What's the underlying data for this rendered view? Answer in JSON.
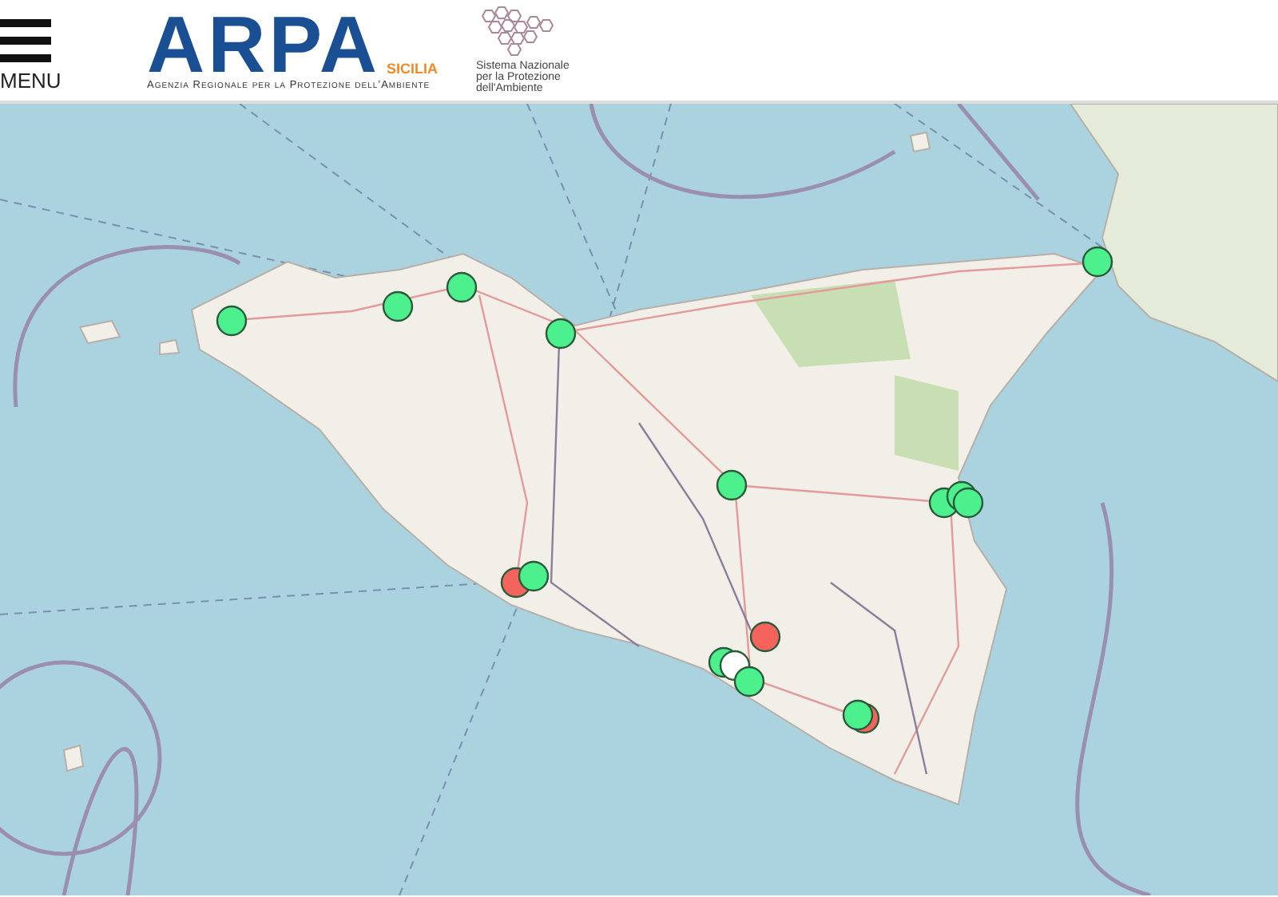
{
  "header": {
    "menu_label": "MENU",
    "logo": {
      "letters": "ARPA",
      "region": "SICILIA",
      "tagline": "Agenzia Regionale per la Protezione dell’Ambiente"
    },
    "partner": {
      "lines": [
        "Sistema Nazionale",
        "per la Protezione",
        "dell'Ambiente"
      ]
    }
  },
  "map": {
    "markers": [
      {
        "color": "#4cf08c"
      },
      {
        "color": "#4cf08c"
      },
      {
        "color": "#4cf08c"
      },
      {
        "color": "#4cf08c"
      },
      {
        "color": "#4cf08c"
      },
      {
        "color": "#4cf08c"
      },
      {
        "color": "#4cf08c"
      },
      {
        "color": "#4cf08c"
      },
      {
        "color": "#4cf08c"
      },
      {
        "color": "#f4645c"
      },
      {
        "color": "#4cf08c"
      },
      {
        "color": "#f4645c"
      },
      {
        "color": "#4cf08c"
      },
      {
        "color": "#ffffff"
      },
      {
        "color": "#4cf08c"
      },
      {
        "color": "#f4645c"
      },
      {
        "color": "#4cf08c"
      }
    ]
  }
}
